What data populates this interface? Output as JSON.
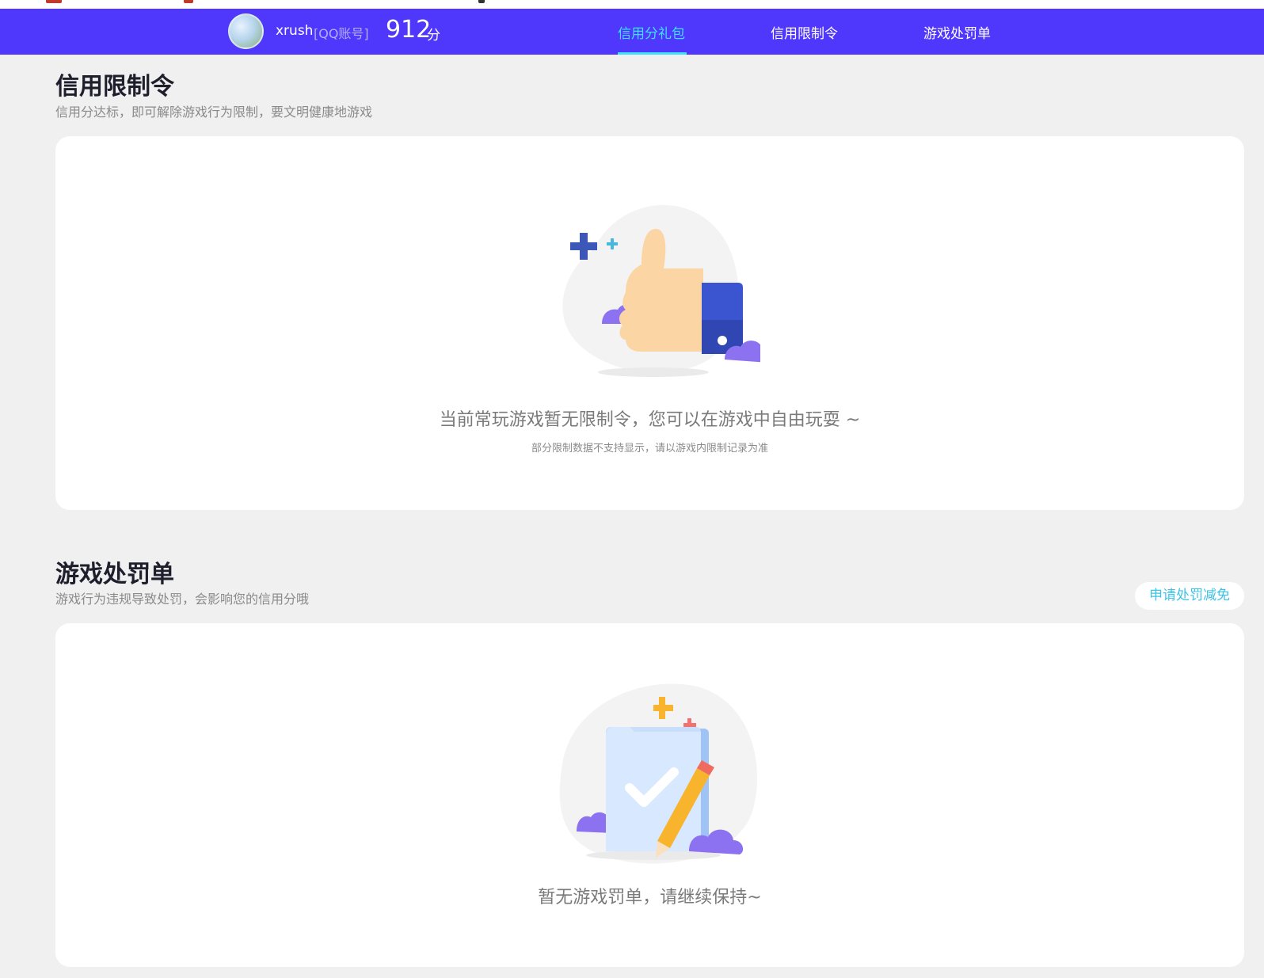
{
  "header": {
    "username": "xrush",
    "account_type": "[QQ账号]",
    "score": "912",
    "score_unit": "分",
    "tabs": [
      {
        "label": "信用分礼包",
        "active": true
      },
      {
        "label": "信用限制令",
        "active": false
      },
      {
        "label": "游戏处罚单",
        "active": false
      }
    ]
  },
  "restriction_section": {
    "title": "信用限制令",
    "subtitle": "信用分达标，即可解除游戏行为限制，要文明健康地游戏",
    "empty_text": "当前常玩游戏暂无限制令，您可以在游戏中自由玩耍 ~",
    "empty_note": "部分限制数据不支持显示，请以游戏内限制记录为准"
  },
  "penalty_section": {
    "title": "游戏处罚单",
    "subtitle": "游戏行为违规导致处罚，会影响您的信用分哦",
    "reduce_button": "申请处罚减免",
    "empty_text": "暂无游戏罚单，请继续保持~"
  },
  "colors": {
    "header_bg": "#4f37fb",
    "active_tab": "#3fe0ff",
    "page_bg": "#f0f0f0",
    "link": "#3dc3e8"
  },
  "icons": [
    "thumbs-up-illustration",
    "document-check-illustration",
    "avatar"
  ]
}
